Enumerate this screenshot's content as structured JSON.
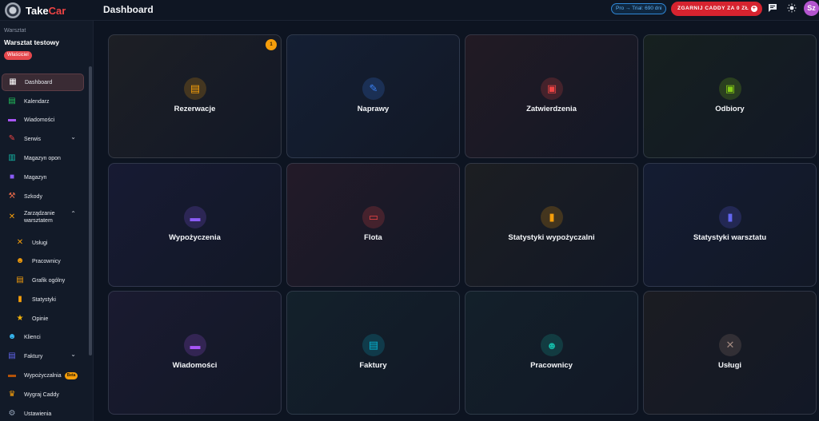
{
  "app": {
    "brand_main": "Take",
    "brand_accent": "Car",
    "page_title": "Dashboard"
  },
  "topbar": {
    "trial_text": "Pro → Trial: 690 dni",
    "cta_label": "ZGARNIJ CADDY ZA 0 ZŁ",
    "cta_icon": "+",
    "chat_icon": "chat-icon",
    "theme_icon": "sun-icon",
    "avatar_initials": "Sz"
  },
  "sidebar": {
    "workspace_label": "Warsztat",
    "workspace_name": "Warsztat testowy",
    "role_badge": "Właściciel",
    "items": [
      {
        "label": "Dashboard",
        "icon": "dashboard-icon",
        "glyph": "▦",
        "color": "#ffffff",
        "active": true
      },
      {
        "label": "Kalendarz",
        "icon": "calendar-icon",
        "glyph": "▤",
        "color": "#22c55e"
      },
      {
        "label": "Wiadomości",
        "icon": "message-icon",
        "glyph": "▬",
        "color": "#a855f7"
      },
      {
        "label": "Serwis",
        "icon": "wrench-icon",
        "glyph": "✎",
        "color": "#ef4444",
        "chevron": "⌄"
      },
      {
        "label": "Magazyn opon",
        "icon": "garage-icon",
        "glyph": "▥",
        "color": "#14b8a6"
      },
      {
        "label": "Magazyn",
        "icon": "box-icon",
        "glyph": "■",
        "color": "#8b5cf6"
      },
      {
        "label": "Szkody",
        "icon": "hammer-icon",
        "glyph": "⚒",
        "color": "#ef6b4a"
      },
      {
        "label": "Zarządzanie warsztatem",
        "icon": "tools-icon",
        "glyph": "✕",
        "color": "#f59e0b",
        "chevron": "⌃"
      },
      {
        "label": "Usługi",
        "icon": "tools-icon",
        "glyph": "✕",
        "color": "#f59e0b",
        "sub": true
      },
      {
        "label": "Pracownicy",
        "icon": "people-icon",
        "glyph": "☻",
        "color": "#f59e0b",
        "sub": true
      },
      {
        "label": "Grafik ogólny",
        "icon": "calendar-icon",
        "glyph": "▤",
        "color": "#f59e0b",
        "sub": true
      },
      {
        "label": "Statystyki",
        "icon": "bar-chart-icon",
        "glyph": "▮",
        "color": "#f59e0b",
        "sub": true
      },
      {
        "label": "Opinie",
        "icon": "star-icon",
        "glyph": "★",
        "color": "#f5b40b",
        "sub": true
      },
      {
        "label": "Klienci",
        "icon": "people-icon",
        "glyph": "☻",
        "color": "#38bdf8"
      },
      {
        "label": "Faktury",
        "icon": "invoice-icon",
        "glyph": "▤",
        "color": "#6366f1",
        "chevron": "⌄"
      },
      {
        "label": "Wypożyczalnia",
        "icon": "truck-icon",
        "glyph": "▬",
        "color": "#b45309",
        "badge": "Beta"
      },
      {
        "label": "Wygraj Caddy",
        "icon": "trophy-icon",
        "glyph": "♛",
        "color": "#f59e0b"
      },
      {
        "label": "Ustawienia",
        "icon": "gear-icon",
        "glyph": "⚙",
        "color": "#94a3b8"
      }
    ]
  },
  "tiles": [
    {
      "title": "Rezerwacje",
      "icon": "calendar-icon",
      "glyph": "▤",
      "accent": "#f59e0b",
      "bg": "#1d1f25",
      "badge": "1"
    },
    {
      "title": "Naprawy",
      "icon": "wrench-icon",
      "glyph": "✎",
      "accent": "#3b82f6",
      "bg": "#141f33"
    },
    {
      "title": "Zatwierdzenia",
      "icon": "clipboard-icon",
      "glyph": "▣",
      "accent": "#ef4444",
      "bg": "#221a24"
    },
    {
      "title": "Odbiory",
      "icon": "check-card-icon",
      "glyph": "▣",
      "accent": "#84cc16",
      "bg": "#16201f"
    },
    {
      "title": "Wypożyczenia",
      "icon": "truck-icon",
      "glyph": "▬",
      "accent": "#8b5cf6",
      "bg": "#171a33"
    },
    {
      "title": "Flota",
      "icon": "car-icon",
      "glyph": "▭",
      "accent": "#ef4444",
      "bg": "#231a28"
    },
    {
      "title": "Statystyki wypożyczalni",
      "icon": "bar-chart-icon",
      "glyph": "▮",
      "accent": "#f59e0b",
      "bg": "#1c1e22"
    },
    {
      "title": "Statystyki warsztatu",
      "icon": "bar-chart-icon",
      "glyph": "▮",
      "accent": "#6366f1",
      "bg": "#141c32"
    },
    {
      "title": "Wiadomości",
      "icon": "message-icon",
      "glyph": "▬",
      "accent": "#a855f7",
      "bg": "#1a1a30"
    },
    {
      "title": "Faktury",
      "icon": "invoice-icon",
      "glyph": "▤",
      "accent": "#06b6d4",
      "bg": "#13212b"
    },
    {
      "title": "Pracownicy",
      "icon": "people-icon",
      "glyph": "☻",
      "accent": "#14b8a6",
      "bg": "#13202a"
    },
    {
      "title": "Usługi",
      "icon": "tools-icon",
      "glyph": "✕",
      "accent": "#a1887f",
      "bg": "#1b1c22"
    }
  ]
}
